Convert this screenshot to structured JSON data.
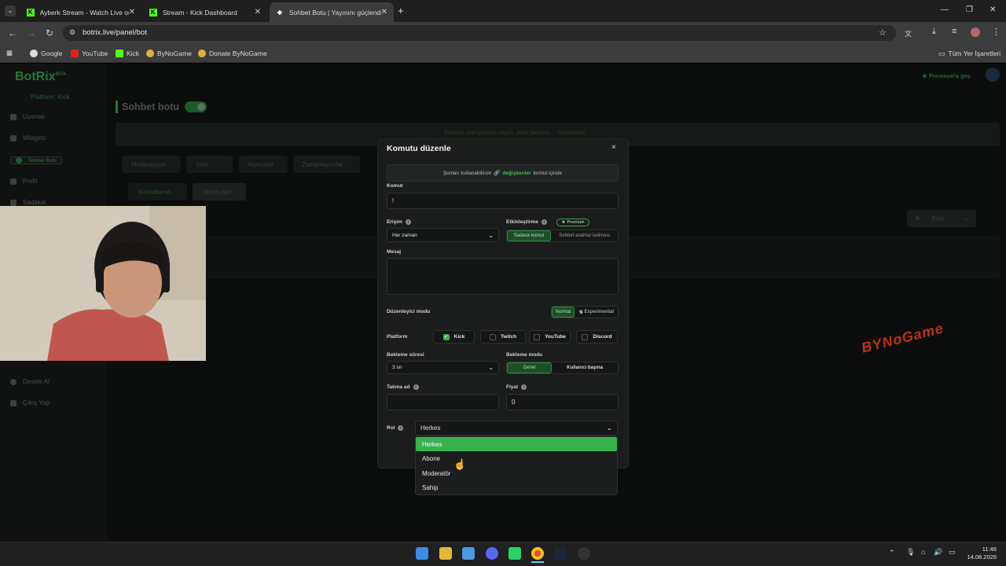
{
  "browser": {
    "tabs": [
      {
        "title": "Ayberk Stream - Watch Live on",
        "active": false
      },
      {
        "title": "Stream - Kick Dashboard",
        "active": false
      },
      {
        "title": "Sohbet Botu | Yayınını güçlendi",
        "active": true
      }
    ],
    "url": "botrix.live/panel/bot",
    "bookmarks": [
      "Google",
      "YouTube",
      "Kick",
      "ByNoGame",
      "Donate ByNoGame"
    ],
    "all_bookmarks": "Tüm Yer İşaretleri"
  },
  "app": {
    "logo": "BotRix",
    "logo_badge": "BETA",
    "platform_label": "Platform: Kick",
    "premium_link": "Premium'a geç",
    "page_title": "Sohbet botu",
    "sidebar": [
      "Uyarılar",
      "Widgets",
      "Sohbet Botu",
      "Profil",
      "Sadakat",
      "Destek Al",
      "Çıkış Yap"
    ],
    "tabs": [
      "Moderasyon",
      "İsim",
      "Komutlar",
      "Zamanlayıcılar"
    ],
    "subtabs": [
      "Komutlarım",
      "Varsayılan"
    ],
    "add_button": "Ekle",
    "banner": "BotRix'e özel yenimizi yaptık, ekibi yanında, ... sohbetinde."
  },
  "modal": {
    "title": "Komutu düzenle",
    "close": "×",
    "info_prefix": "Şunları kullanabilirsin",
    "info_link": "değişkenler",
    "info_suffix": "komut içinde",
    "command_label": "Komut",
    "command_value": "!",
    "access_label": "Erişim",
    "access_value": "Her zaman",
    "activation_label": "Etkinleştirme",
    "premium_badge": "Premium",
    "activation_options": [
      "Sadece komut",
      "Sohbet anahtar kelimesi"
    ],
    "message_label": "Mesaj",
    "editor_mode_label": "Düzenleyici modu",
    "editor_modes": [
      "Normal",
      "Experimental"
    ],
    "platform_label": "Platform",
    "platforms": [
      {
        "name": "Kick",
        "checked": true
      },
      {
        "name": "Twitch",
        "checked": false
      },
      {
        "name": "YouTube",
        "checked": false
      },
      {
        "name": "Discord",
        "checked": false
      }
    ],
    "cooldown_label": "Bekleme süresi",
    "cooldown_value": "3 sn",
    "cooldown_mode_label": "Bekleme modu",
    "cooldown_modes": [
      "Genel",
      "Kullanıcı başına"
    ],
    "alias_label": "Takma ad",
    "alias_value": "",
    "price_label": "Fiyat",
    "price_value": "0",
    "role_label": "Rol",
    "role_value": "Herkes",
    "role_options": [
      "Herkes",
      "Abone",
      "Moderatör",
      "Sahip"
    ]
  },
  "watermark": "BYNoGame",
  "clock": {
    "time": "11:46",
    "date": "14.08.2026"
  }
}
